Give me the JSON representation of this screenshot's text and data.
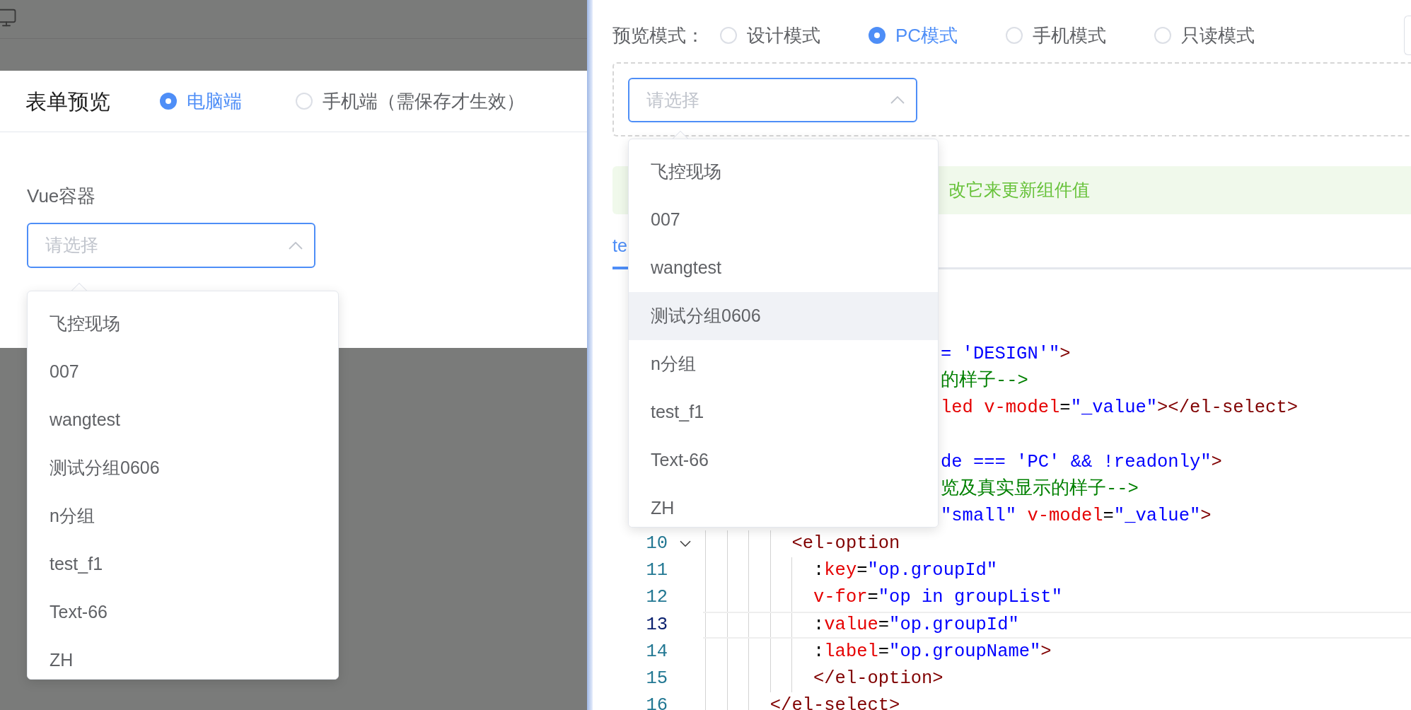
{
  "form_preview": {
    "title": "表单预览",
    "device_options": [
      {
        "label": "电脑端",
        "selected": true
      },
      {
        "label": "手机端（需保存才生效）",
        "selected": false
      }
    ],
    "field": {
      "label": "Vue容器",
      "select": {
        "placeholder": "请选择",
        "expanded": true
      }
    },
    "dropdown": [
      {
        "label": "飞控现场",
        "hovered": false
      },
      {
        "label": "007",
        "hovered": false
      },
      {
        "label": "wangtest",
        "hovered": false
      },
      {
        "label": "测试分组0606",
        "hovered": false
      },
      {
        "label": "n分组",
        "hovered": false
      },
      {
        "label": "test_f1",
        "hovered": false
      },
      {
        "label": "Text-66",
        "hovered": false
      },
      {
        "label": "ZH",
        "hovered": false
      }
    ]
  },
  "preview_panel": {
    "mode_label": "预览模式：",
    "modes": [
      {
        "label": "设计模式",
        "selected": false
      },
      {
        "label": "PC模式",
        "selected": true
      },
      {
        "label": "手机模式",
        "selected": false
      },
      {
        "label": "只读模式",
        "selected": false
      }
    ],
    "select": {
      "placeholder": "请选择",
      "expanded": true
    },
    "dropdown": [
      {
        "label": "飞控现场",
        "hovered": false
      },
      {
        "label": "007",
        "hovered": false
      },
      {
        "label": "wangtest",
        "hovered": false
      },
      {
        "label": "测试分组0606",
        "hovered": true
      },
      {
        "label": "n分组",
        "hovered": false
      },
      {
        "label": "test_f1",
        "hovered": false
      },
      {
        "label": "Text-66",
        "hovered": false
      },
      {
        "label": "ZH",
        "hovered": false
      }
    ],
    "alert": "改它来更新组件值",
    "tabs": [
      {
        "label": "te",
        "selected": true
      }
    ],
    "code_lines": [
      {
        "kind": "blank"
      },
      {
        "kind": "blank"
      },
      {
        "kind": "fragment",
        "tokens": [
          {
            "kind": "str",
            "text": "= 'DESIGN'\""
          },
          {
            "kind": "tag",
            "text": ">"
          }
        ]
      },
      {
        "kind": "fragment",
        "tokens": [
          {
            "kind": "comment",
            "text": "的样子-->"
          }
        ]
      },
      {
        "kind": "fragment",
        "tokens": [
          {
            "kind": "attr",
            "text": "led v-model"
          },
          {
            "kind": "plain",
            "text": "="
          },
          {
            "kind": "str",
            "text": "\"_value\""
          },
          {
            "kind": "tag",
            "text": "></el-select>"
          }
        ]
      },
      {
        "kind": "blank"
      },
      {
        "kind": "fragment",
        "tokens": [
          {
            "kind": "str",
            "text": "de === 'PC' && !readonly\""
          },
          {
            "kind": "tag",
            "text": ">"
          }
        ]
      },
      {
        "kind": "fragment",
        "tokens": [
          {
            "kind": "comment",
            "text": "览及真实显示的样子-->"
          }
        ]
      },
      {
        "kind": "fragment",
        "tokens": [
          {
            "kind": "str",
            "text": "\"small\""
          },
          {
            "kind": "attr",
            "text": " v-model"
          },
          {
            "kind": "plain",
            "text": "="
          },
          {
            "kind": "str",
            "text": "\"_value\""
          },
          {
            "kind": "tag",
            "text": ">"
          }
        ]
      },
      {
        "kind": "numbered",
        "number": "10",
        "current": false,
        "foldable": true,
        "tokens": [
          {
            "kind": "tag",
            "text": "        <el-option"
          }
        ]
      },
      {
        "kind": "numbered",
        "number": "11",
        "current": false,
        "foldable": false,
        "tokens": [
          {
            "kind": "plain",
            "text": "          :"
          },
          {
            "kind": "attr",
            "text": "key"
          },
          {
            "kind": "plain",
            "text": "="
          },
          {
            "kind": "str",
            "text": "\"op.groupId\""
          }
        ]
      },
      {
        "kind": "numbered",
        "number": "12",
        "current": false,
        "foldable": false,
        "tokens": [
          {
            "kind": "attr",
            "text": "          v-for"
          },
          {
            "kind": "plain",
            "text": "="
          },
          {
            "kind": "str",
            "text": "\"op in groupList\""
          }
        ]
      },
      {
        "kind": "numbered",
        "number": "13",
        "current": true,
        "foldable": false,
        "tokens": [
          {
            "kind": "plain",
            "text": "          :"
          },
          {
            "kind": "attr",
            "text": "value"
          },
          {
            "kind": "plain",
            "text": "="
          },
          {
            "kind": "str",
            "text": "\"op.groupId\""
          }
        ]
      },
      {
        "kind": "numbered",
        "number": "14",
        "current": false,
        "foldable": false,
        "tokens": [
          {
            "kind": "plain",
            "text": "          :"
          },
          {
            "kind": "attr",
            "text": "label"
          },
          {
            "kind": "plain",
            "text": "="
          },
          {
            "kind": "str",
            "text": "\"op.groupName\""
          },
          {
            "kind": "tag",
            "text": ">"
          }
        ]
      },
      {
        "kind": "numbered",
        "number": "15",
        "current": false,
        "foldable": false,
        "tokens": [
          {
            "kind": "tag",
            "text": "          </el-option>"
          }
        ]
      },
      {
        "kind": "numbered",
        "number": "16",
        "current": false,
        "foldable": false,
        "tokens": [
          {
            "kind": "tag",
            "text": "      </el-select>"
          }
        ]
      }
    ]
  }
}
